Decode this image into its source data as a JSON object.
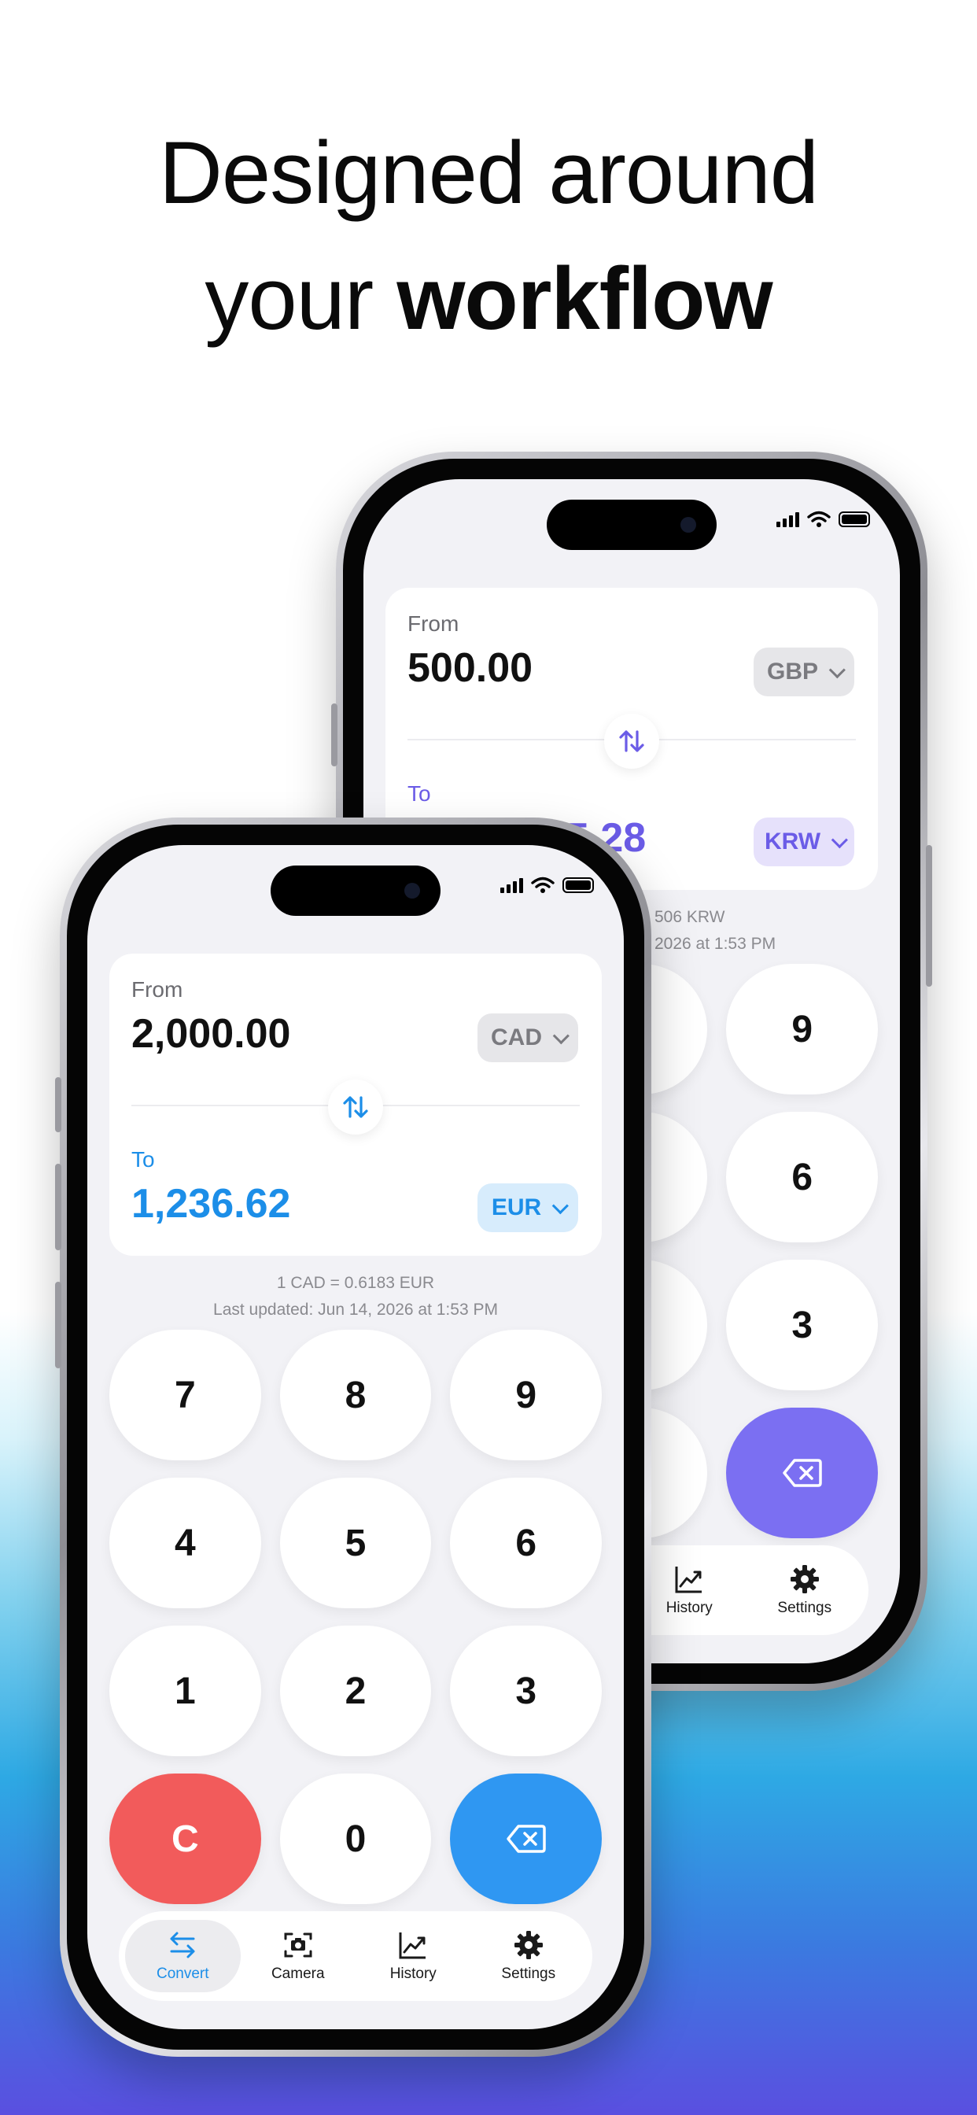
{
  "headline": {
    "line1": "Designed around",
    "line2_prefix": "your ",
    "line2_bold": "workflow"
  },
  "colors": {
    "accent_blue": "#1c8ee8",
    "accent_purple": "#6b5ce7",
    "clear_red": "#f25b5b",
    "delete_blue": "#2f97f2",
    "delete_purple": "#7b6ff2"
  },
  "phone_back": {
    "from_label": "From",
    "from_amount": "500.00",
    "from_currency": "GBP",
    "to_label": "To",
    "to_amount": "5.28",
    "to_currency": "KRW",
    "rate_line": "506 KRW",
    "updated_line": "2026 at 1:53 PM",
    "keys": [
      "",
      "9",
      "",
      "6",
      "",
      "3",
      "",
      ""
    ],
    "tabs": [
      {
        "label": "History",
        "icon": "chart-icon"
      },
      {
        "label": "Settings",
        "icon": "gear-icon"
      }
    ]
  },
  "phone_front": {
    "from_label": "From",
    "from_amount": "2,000.00",
    "from_currency": "CAD",
    "to_label": "To",
    "to_amount": "1,236.62",
    "to_currency": "EUR",
    "rate_line": "1 CAD = 0.6183 EUR",
    "updated_line": "Last updated: Jun 14, 2026 at 1:53 PM",
    "keys": [
      "7",
      "8",
      "9",
      "4",
      "5",
      "6",
      "1",
      "2",
      "3",
      "C",
      "0",
      ""
    ],
    "tabs": [
      {
        "label": "Convert",
        "icon": "swap-arrows-icon",
        "active": true
      },
      {
        "label": "Camera",
        "icon": "camera-icon"
      },
      {
        "label": "History",
        "icon": "chart-icon"
      },
      {
        "label": "Settings",
        "icon": "gear-icon"
      }
    ]
  }
}
